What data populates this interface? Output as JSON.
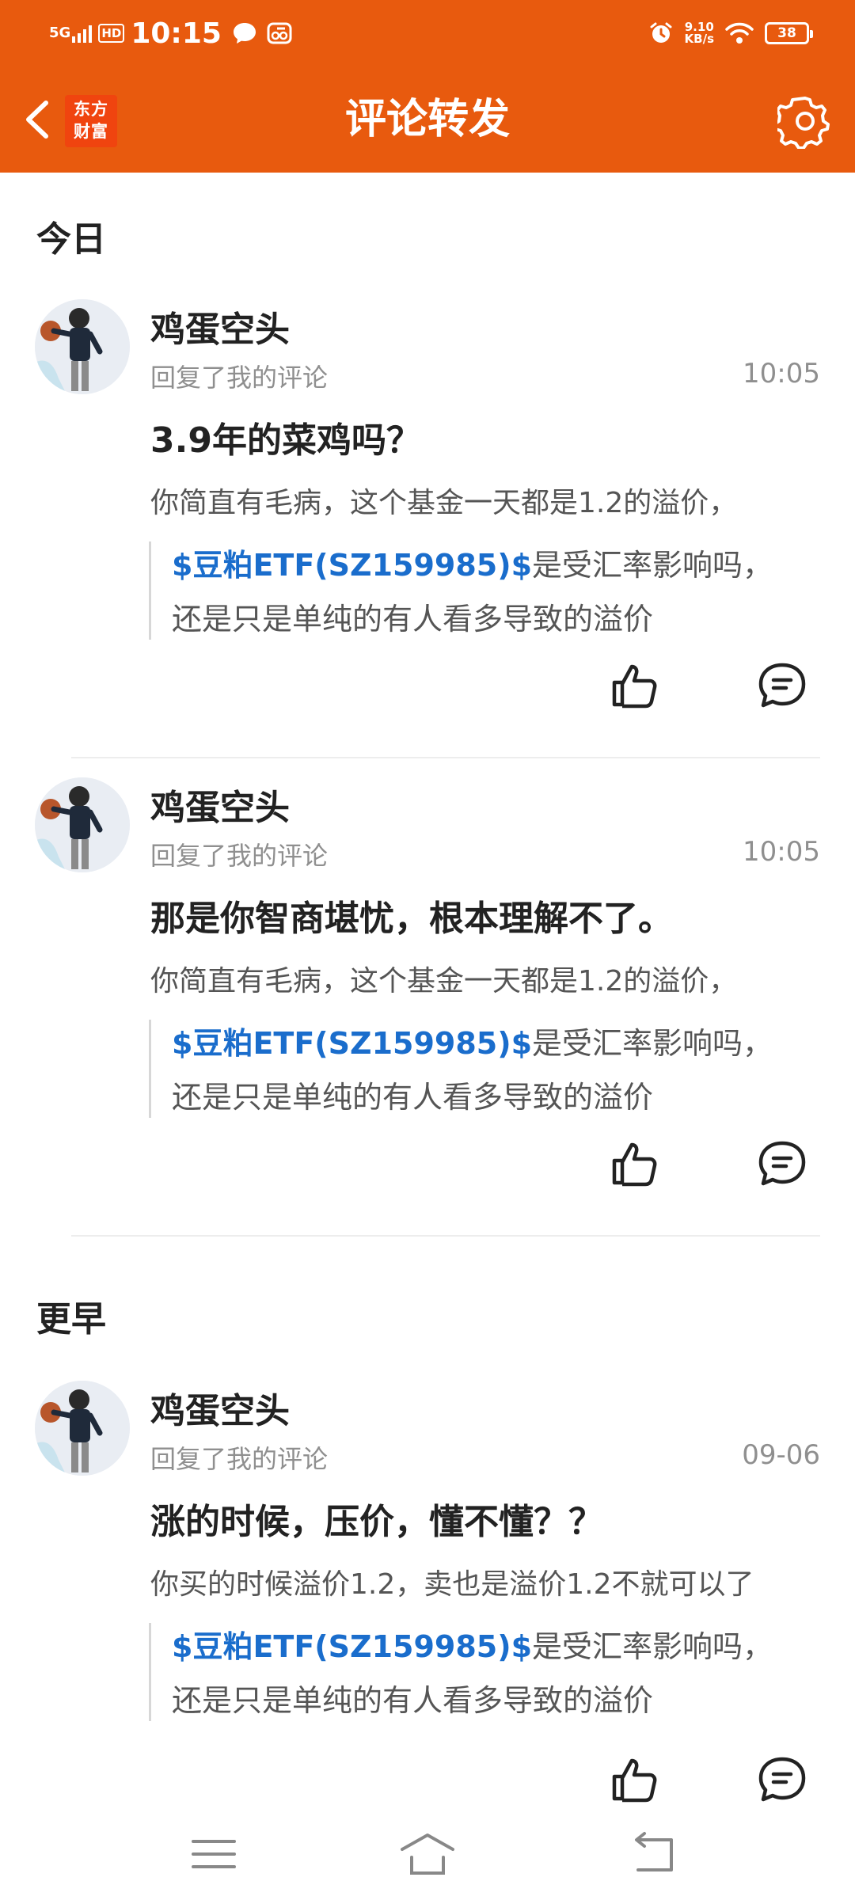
{
  "status_bar": {
    "network": "5G",
    "hd": "HD",
    "time": "10:15",
    "speed_value": "9.10",
    "speed_unit": "KB/s",
    "battery": "38",
    "icons": [
      "signal-icon",
      "hd-icon",
      "chat-icon",
      "app-icon",
      "alarm-icon",
      "wifi-icon",
      "battery-icon"
    ]
  },
  "header": {
    "title": "评论转发",
    "logo_line1": "东方",
    "logo_line2": "财富",
    "back_icon": "chevron-left-icon",
    "settings_icon": "gear-icon"
  },
  "colors": {
    "brand": "#e85a0e",
    "stock_link": "#1a6dcc"
  },
  "sections": [
    {
      "title": "今日",
      "items": [
        {
          "user": "鸡蛋空头",
          "action": "回复了我的评论",
          "time": "10:05",
          "reply": "3.9年的菜鸡吗？",
          "original": "你简直有毛病，这个基金一天都是1.2的溢价，",
          "quote_stock": "$豆粕ETF(SZ159985)$",
          "quote_rest": "是受汇率影响吗，",
          "quote_line2": "还是只是单纯的有人看多导致的溢价"
        },
        {
          "user": "鸡蛋空头",
          "action": "回复了我的评论",
          "time": "10:05",
          "reply": "那是你智商堪忧，根本理解不了。",
          "original": "你简直有毛病，这个基金一天都是1.2的溢价，",
          "quote_stock": "$豆粕ETF(SZ159985)$",
          "quote_rest": "是受汇率影响吗，",
          "quote_line2": "还是只是单纯的有人看多导致的溢价"
        }
      ]
    },
    {
      "title": "更早",
      "items": [
        {
          "user": "鸡蛋空头",
          "action": "回复了我的评论",
          "time": "09-06",
          "reply": "涨的时候，压价，懂不懂？？",
          "original": "你买的时候溢价1.2，卖也是溢价1.2不就可以了",
          "quote_stock": "$豆粕ETF(SZ159985)$",
          "quote_rest": "是受汇率影响吗，",
          "quote_line2": "还是只是单纯的有人看多导致的溢价"
        }
      ]
    }
  ],
  "system_nav": {
    "icons": [
      "menu-icon",
      "home-icon",
      "back-icon"
    ]
  }
}
